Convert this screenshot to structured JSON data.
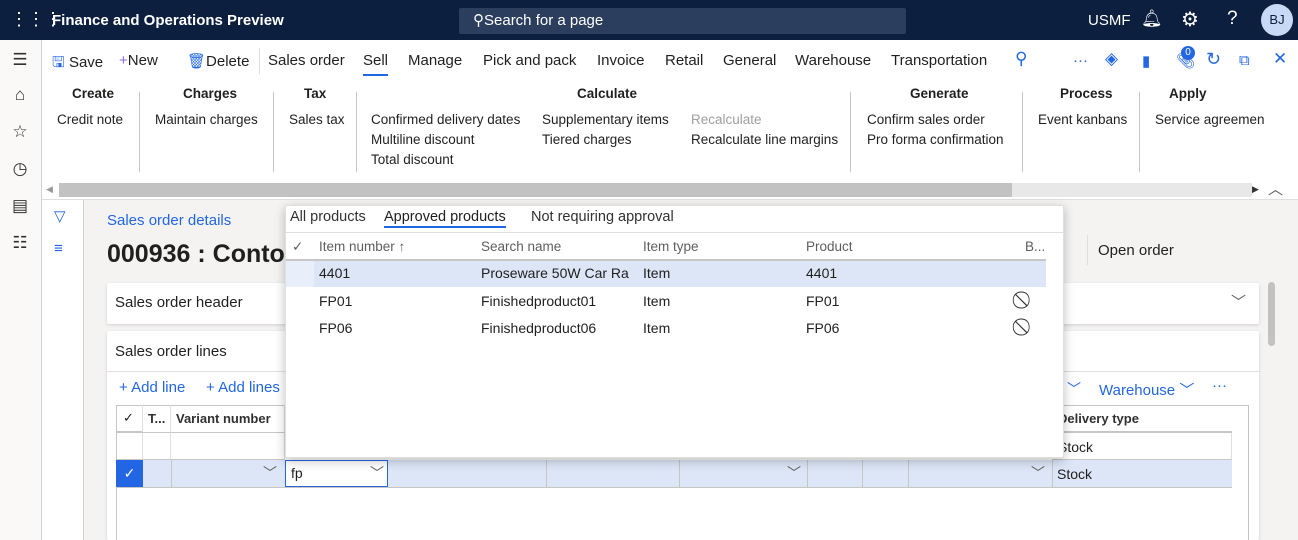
{
  "app": {
    "title": "Finance and Operations Preview",
    "search_placeholder": "Search for a page",
    "company": "USMF",
    "avatar": "BJ"
  },
  "toolbar": {
    "save": "Save",
    "new": "New",
    "delete": "Delete",
    "tabs": [
      "Sales order",
      "Sell",
      "Manage",
      "Pick and pack",
      "Invoice",
      "Retail",
      "General",
      "Warehouse",
      "Transportation"
    ],
    "active_tab": "Sell",
    "attachments_count": "0"
  },
  "ribbon": {
    "create": {
      "title": "Create",
      "items": [
        "Credit note"
      ]
    },
    "charges": {
      "title": "Charges",
      "items": [
        "Maintain charges"
      ]
    },
    "tax": {
      "title": "Tax",
      "items": [
        "Sales tax"
      ]
    },
    "calculate": {
      "title": "Calculate",
      "col1": [
        "Confirmed delivery dates",
        "Multiline discount",
        "Total discount"
      ],
      "col2": [
        "Supplementary items",
        "Tiered charges"
      ],
      "col3": [
        "Recalculate",
        "Recalculate line margins"
      ]
    },
    "generate": {
      "title": "Generate",
      "items": [
        "Confirm sales order",
        "Pro forma confirmation"
      ]
    },
    "process": {
      "title": "Process",
      "items": [
        "Event kanbans"
      ]
    },
    "apply": {
      "title": "Apply",
      "items": [
        "Service agreemen"
      ]
    }
  },
  "page": {
    "breadcrumb": "Sales order details",
    "title": "000936 : Conto",
    "open_order": "Open order",
    "header_section": "Sales order header",
    "lines_section": "Sales order lines",
    "add_line": "Add line",
    "add_lines": "Add lines",
    "warehouse": "Warehouse"
  },
  "grid": {
    "headers": {
      "type": "T...",
      "variant": "Variant number",
      "delivery": "Delivery type"
    },
    "rows": [
      {
        "delivery": "Stock"
      },
      {
        "item_input": "fp",
        "delivery": "Stock"
      }
    ]
  },
  "lookup": {
    "tabs": [
      "All products",
      "Approved products",
      "Not requiring approval"
    ],
    "active_tab": "Approved products",
    "columns": [
      "Item number",
      "Search name",
      "Item type",
      "Product",
      "B..."
    ],
    "rows": [
      {
        "item": "4401",
        "name": "Proseware 50W Car Ra",
        "type": "Item",
        "product": "4401",
        "blocked": false
      },
      {
        "item": "FP01",
        "name": "Finishedproduct01",
        "type": "Item",
        "product": "FP01",
        "blocked": true
      },
      {
        "item": "FP06",
        "name": "Finishedproduct06",
        "type": "Item",
        "product": "FP06",
        "blocked": true
      }
    ]
  },
  "colors": {
    "topbar": "#0c1f3f",
    "accent": "#2266e3",
    "selected_row": "#dce6f7"
  }
}
